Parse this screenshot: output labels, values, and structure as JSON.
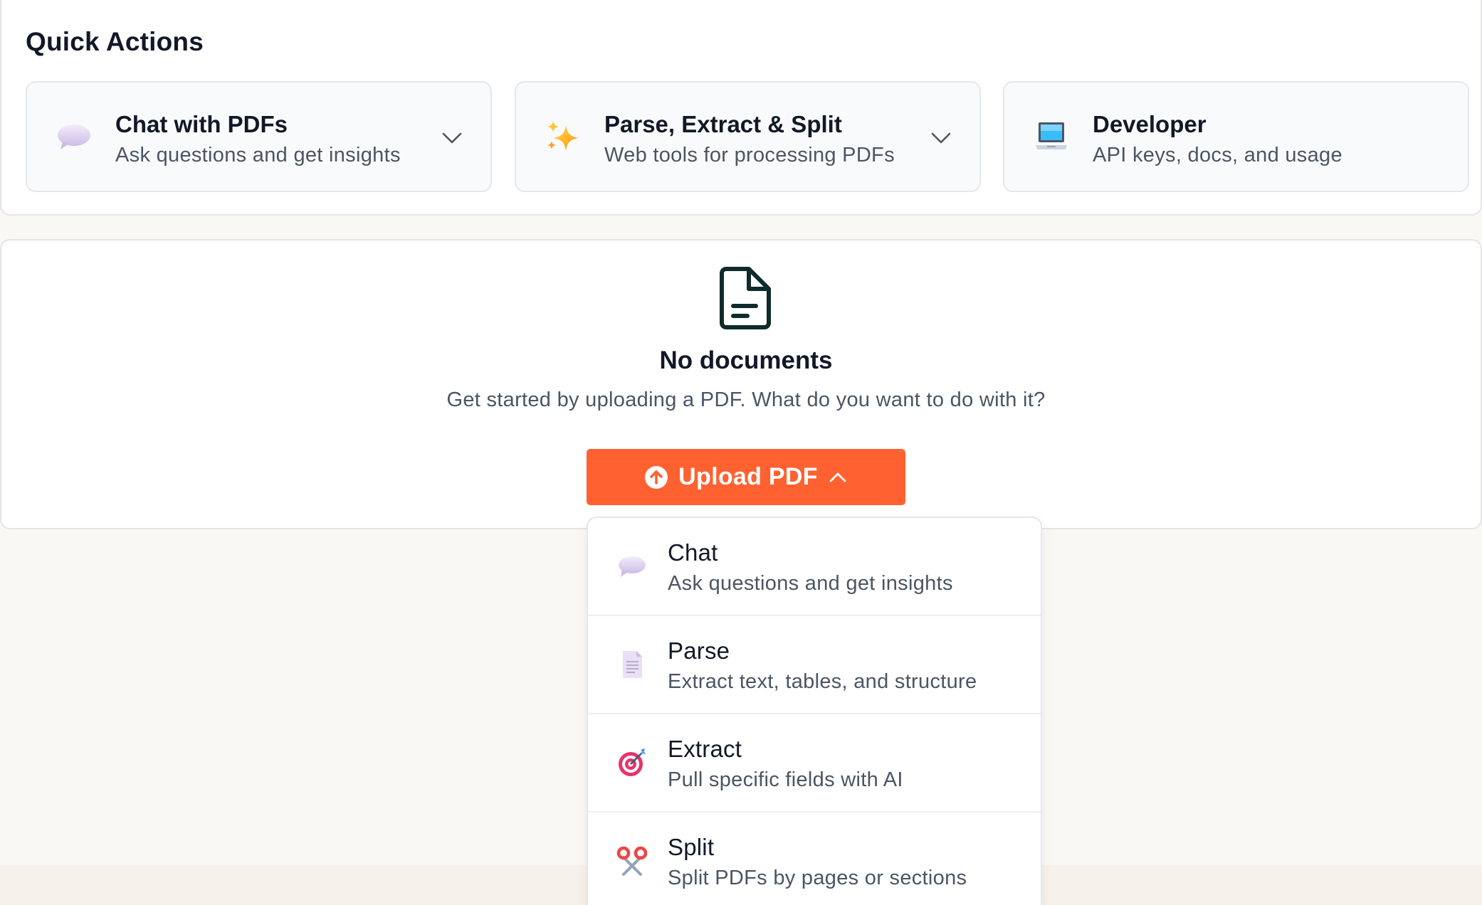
{
  "quick_actions": {
    "title": "Quick Actions",
    "cards": [
      {
        "title": "Chat with PDFs",
        "subtitle": "Ask questions and get insights",
        "icon": "speech-bubble-icon",
        "has_dropdown": true
      },
      {
        "title": "Parse, Extract & Split",
        "subtitle": "Web tools for processing PDFs",
        "icon": "sparkles-icon",
        "has_dropdown": true
      },
      {
        "title": "Developer",
        "subtitle": "API keys, docs, and usage",
        "icon": "laptop-icon",
        "has_dropdown": false
      }
    ]
  },
  "empty_state": {
    "icon": "document-icon",
    "title": "No documents",
    "subtitle": "Get started by uploading a PDF. What do you want to do with it?"
  },
  "upload": {
    "label": "Upload PDF",
    "icon": "upload-arrow-icon",
    "color": "#ff6131",
    "expanded": true
  },
  "menu": {
    "items": [
      {
        "title": "Chat",
        "subtitle": "Ask questions and get insights",
        "icon": "speech-bubble-icon"
      },
      {
        "title": "Parse",
        "subtitle": "Extract text, tables, and structure",
        "icon": "page-icon"
      },
      {
        "title": "Extract",
        "subtitle": "Pull specific fields with AI",
        "icon": "target-icon"
      },
      {
        "title": "Split",
        "subtitle": "Split PDFs by pages or sections",
        "icon": "scissors-icon"
      }
    ]
  }
}
